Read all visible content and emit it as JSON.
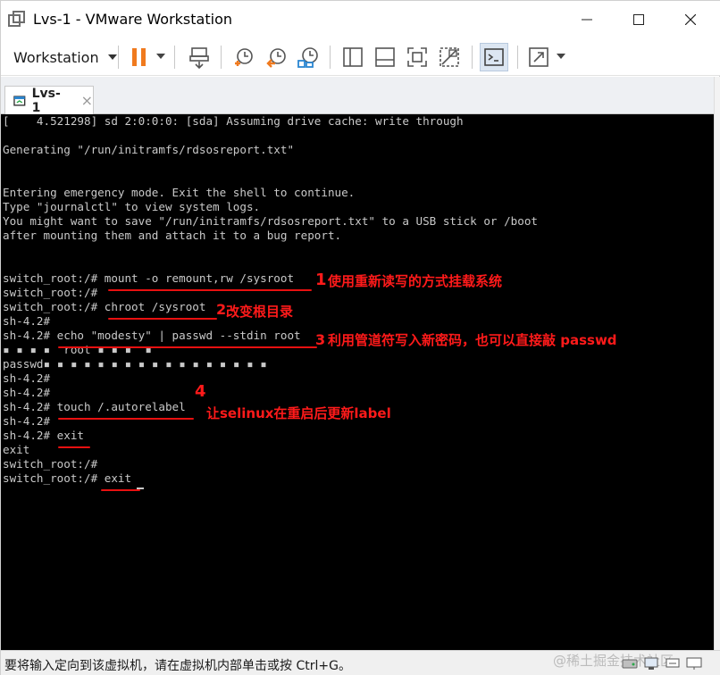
{
  "window": {
    "title": "Lvs-1 - VMware Workstation"
  },
  "toolbar": {
    "workstation_label": "Workstation"
  },
  "tabs": [
    {
      "label": "Lvs-1",
      "close": "×"
    }
  ],
  "console": {
    "lines": [
      "[    4.521298] sd 2:0:0:0: [sda] Assuming drive cache: write through",
      "",
      "Generating \"/run/initramfs/rdsosreport.txt\"",
      "",
      "",
      "Entering emergency mode. Exit the shell to continue.",
      "Type \"journalctl\" to view system logs.",
      "You might want to save \"/run/initramfs/rdsosreport.txt\" to a USB stick or /boot",
      "after mounting them and attach it to a bug report.",
      "",
      "",
      "switch_root:/# mount -o remount,rw /sysroot",
      "switch_root:/#",
      "switch_root:/# chroot /sysroot",
      "sh-4.2#",
      "sh-4.2# echo \"modesty\" | passwd --stdin root",
      "▪ ▪ ▪ ▪  root ▪ ▪ ▪  ▪",
      "passwd▪ ▪ ▪ ▪ ▪ ▪ ▪ ▪ ▪ ▪ ▪ ▪ ▪ ▪ ▪ ▪ ▪",
      "sh-4.2#",
      "sh-4.2#",
      "sh-4.2# touch /.autorelabel",
      "sh-4.2#",
      "sh-4.2# exit",
      "exit",
      "switch_root:/#",
      "switch_root:/# exit"
    ]
  },
  "annotations": {
    "step1": "使用重新读写的方式挂载系统",
    "step2": "改变根目录",
    "step3": "利用管道符写入新密码，也可以直接敲 passwd",
    "step4": "让selinux在重启后更新label",
    "mark1": "1",
    "mark2": "2",
    "mark3": "3",
    "mark4": "4"
  },
  "statusbar": {
    "hint": "要将输入定向到该虚拟机，请在虚拟机内部单击或按 Ctrl+G。",
    "watermark": "@稀土掘金技术社区"
  },
  "colors": {
    "console_bg": "#000000",
    "console_fg": "#c9c9c9",
    "annotation": "#ff1a1a",
    "pause_orange": "#f07a1e"
  }
}
